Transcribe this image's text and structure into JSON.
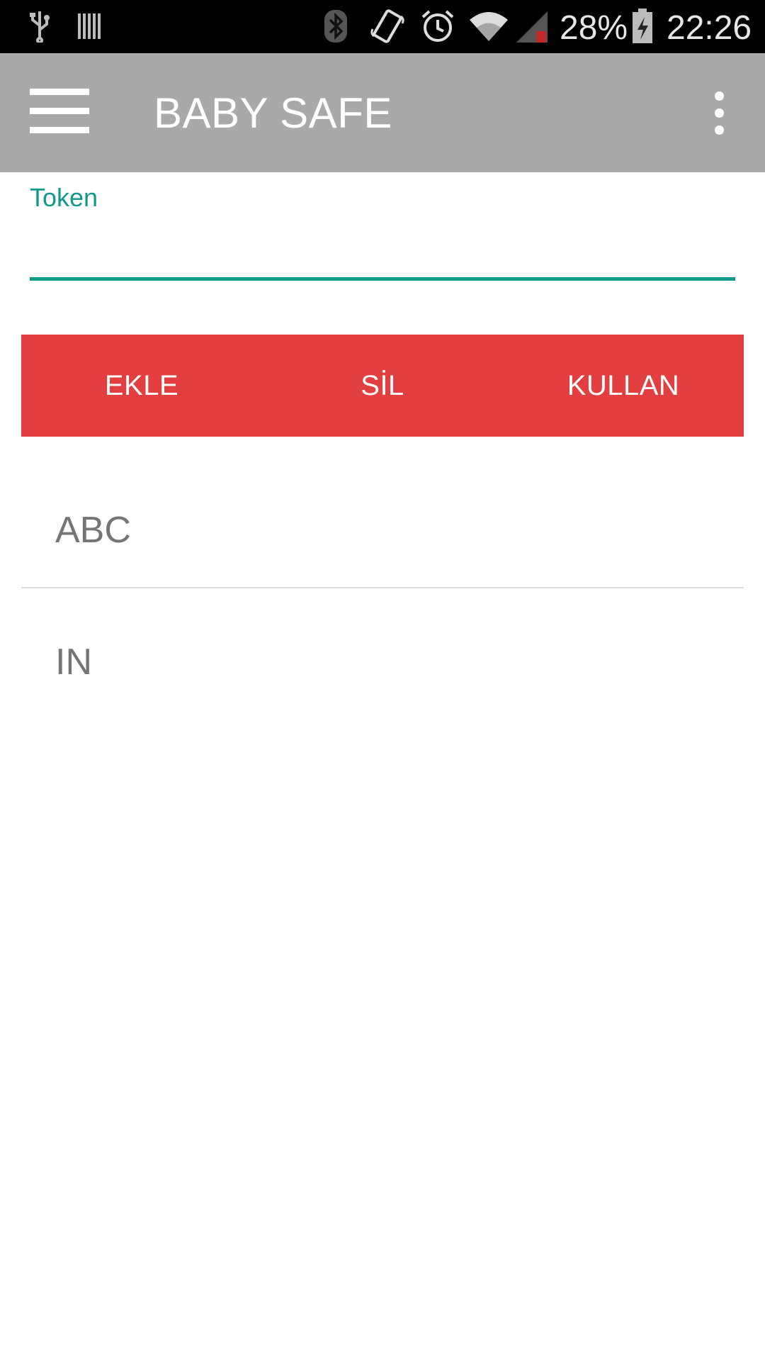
{
  "status_bar": {
    "icons": [
      "usb-icon",
      "barcode-icon",
      "bluetooth-icon",
      "vibrate-icon",
      "alarm-icon",
      "wifi-icon",
      "signal-icon",
      "battery-icon"
    ],
    "battery_percent": "28%",
    "time": "22:26"
  },
  "toolbar": {
    "menu_icon": "hamburger-menu-icon",
    "title": "BABY SAFE",
    "overflow_icon": "more-vert-icon"
  },
  "token_field": {
    "label": "Token",
    "value": "",
    "accent_color": "#12998a"
  },
  "actions": {
    "color": "#e33f41",
    "add_label": "EKLE",
    "delete_label": "SİL",
    "use_label": "KULLAN"
  },
  "list": {
    "items": [
      {
        "label": "ABC"
      },
      {
        "label": "IN"
      }
    ]
  }
}
